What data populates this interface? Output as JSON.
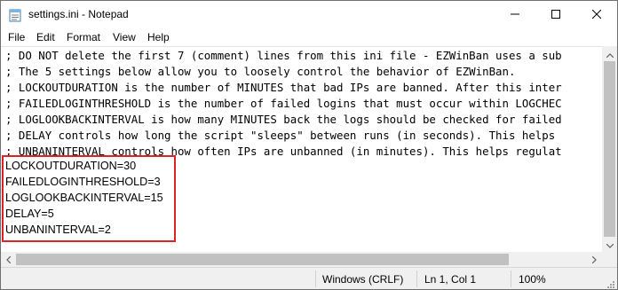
{
  "window": {
    "title": "settings.ini - Notepad"
  },
  "menu": [
    "File",
    "Edit",
    "Format",
    "View",
    "Help"
  ],
  "editor": {
    "comment_lines": [
      "; DO NOT delete the first 7 (comment) lines from this ini file - EZWinBan uses a sub",
      "; The 5 settings below allow you to loosely control the behavior of EZWinBan.",
      "; LOCKOUTDURATION is the number of MINUTES that bad IPs are banned. After this inter",
      "; FAILEDLOGINTHRESHOLD is the number of failed logins that must occur within LOGCHEC",
      "; LOGLOOKBACKINTERVAL is how many MINUTES back the logs should be checked for failed",
      "; DELAY controls how long the script \"sleeps\" between runs (in seconds). This helps",
      "; UNBANINTERVAL controls how often IPs are unbanned (in minutes). This helps regulat"
    ],
    "settings_lines": [
      "LOCKOUTDURATION=30",
      "FAILEDLOGINTHRESHOLD=3",
      "LOGLOOKBACKINTERVAL=15",
      "DELAY=5",
      "UNBANINTERVAL=2"
    ],
    "highlight_color": "#d8232a"
  },
  "status": {
    "encoding": "Windows (CRLF)",
    "position": "Ln 1, Col 1",
    "zoom": "100%"
  },
  "icons": {
    "app": "notepad-icon",
    "minimize": "minimize-icon",
    "maximize": "maximize-icon",
    "close": "close-icon"
  }
}
